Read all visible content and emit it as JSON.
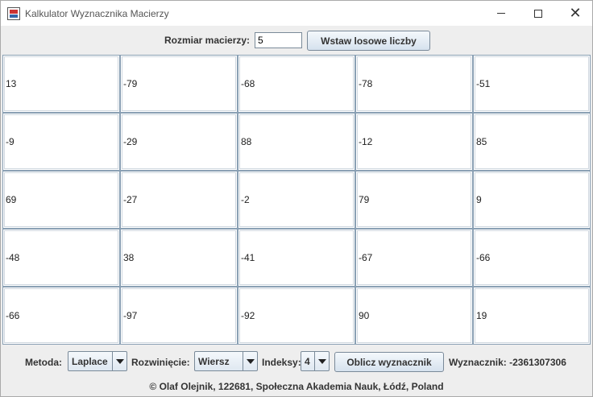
{
  "window": {
    "title": "Kalkulator Wyznacznika Macierzy",
    "controls": {
      "minimize": "minimize-icon",
      "maximize": "maximize-icon",
      "close": "close-icon"
    }
  },
  "top": {
    "size_label": "Rozmiar macierzy:",
    "size_value": "5",
    "random_button": "Wstaw losowe liczby"
  },
  "matrix": [
    [
      "13",
      "-79",
      "-68",
      "-78",
      "-51"
    ],
    [
      "-9",
      "-29",
      "88",
      "-12",
      "85"
    ],
    [
      "69",
      "-27",
      "-2",
      "79",
      "9"
    ],
    [
      "-48",
      "38",
      "-41",
      "-67",
      "-66"
    ],
    [
      "-66",
      "-97",
      "-92",
      "90",
      "19"
    ]
  ],
  "bottom": {
    "method_label": "Metoda:",
    "method_value": "Laplace",
    "expansion_label": "Rozwinięcie:",
    "expansion_value": "Wiersz",
    "index_label": "Indeksy:",
    "index_value": "4",
    "calc_button": "Oblicz wyznacznik",
    "result_text": "Wyznacznik: -2361307306"
  },
  "footer": "© Olaf Olejnik, 122681, Społeczna Akademia Nauk, Łódź, Poland"
}
